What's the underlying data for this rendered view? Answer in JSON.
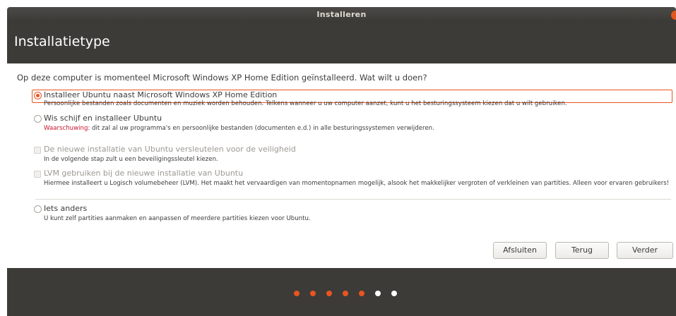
{
  "window": {
    "title": "Installeren"
  },
  "header": {
    "title": "Installatietype"
  },
  "question": "Op deze computer is momenteel Microsoft Windows XP Home Edition geïnstalleerd. Wat wilt u doen?",
  "options": [
    {
      "label": "Installeer Ubuntu naast Microsoft Windows XP Home Edition",
      "desc": "Persoonlijke bestanden zoals documenten en muziek worden behouden. Telkens wanneer u uw computer aanzet, kunt u het besturingssysteem kiezen dat u wilt gebruiken.",
      "checked": true
    },
    {
      "label": "Wis schijf en installeer Ubuntu",
      "warn_label": "Waarschuwing:",
      "desc": " dit zal al uw programma's en persoonlijke bestanden (documenten e.d.) in alle besturingssystemen verwijderen.",
      "checked": false
    },
    {
      "label": "De nieuwe installatie van Ubuntu versleutelen voor de veiligheid",
      "desc": "In de volgende stap zult u een beveiligingssleutel kiezen.",
      "disabled": true
    },
    {
      "label": "LVM gebruiken bij de nieuwe installatie van Ubuntu",
      "desc": "Hiermee installeert u Logisch volumebeheer (LVM). Het maakt het vervaardigen van momentopnamen mogelijk, alsook het makkelijker vergroten of verkleinen van partities. Alleen voor ervaren gebruikers!",
      "disabled": true
    },
    {
      "label": "Iets anders",
      "desc": "U kunt zelf partities aanmaken en aanpassen of meerdere partities kiezen voor Ubuntu.",
      "checked": false
    }
  ],
  "buttons": {
    "quit": "Afsluiten",
    "back": "Terug",
    "next": "Verder"
  },
  "progress": {
    "completed_steps": 5,
    "total_steps": 7,
    "active_color": "#e95420",
    "inactive_color": "#ffffff"
  },
  "colors": {
    "accent": "#e95420",
    "header_bg": "#3c3b37",
    "warning": "#c7162b"
  }
}
